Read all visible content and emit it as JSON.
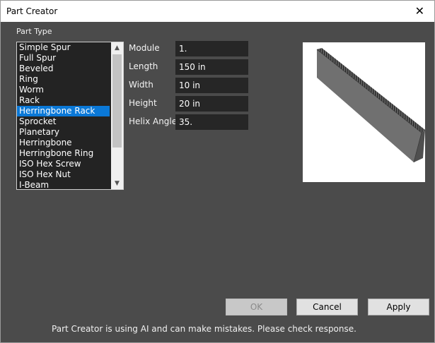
{
  "window": {
    "title": "Part Creator",
    "close_glyph": "✕"
  },
  "part_type": {
    "label": "Part Type",
    "items": [
      "Simple Spur",
      "Full Spur",
      "Beveled",
      "Ring",
      "Worm",
      "Rack",
      "Herringbone Rack",
      "Sprocket",
      "Planetary",
      "Herringbone",
      "Herringbone Ring",
      "ISO Hex Screw",
      "ISO Hex Nut",
      "I-Beam"
    ],
    "selected": "Herringbone Rack"
  },
  "fields": {
    "module": {
      "label": "Module",
      "value": "1."
    },
    "length": {
      "label": "Length",
      "value": "150 in"
    },
    "width": {
      "label": "Width",
      "value": "10 in"
    },
    "height": {
      "label": "Height",
      "value": "20 in"
    },
    "helix_angle": {
      "label": "Helix Angle",
      "value": "35."
    }
  },
  "buttons": {
    "ok": "OK",
    "cancel": "Cancel",
    "apply": "Apply"
  },
  "disclaimer": "Part Creator is using AI and can make mistakes. Please check response.",
  "colors": {
    "selection": "#0a78d7",
    "background": "#4b4b4b",
    "input_bg": "#262626"
  }
}
